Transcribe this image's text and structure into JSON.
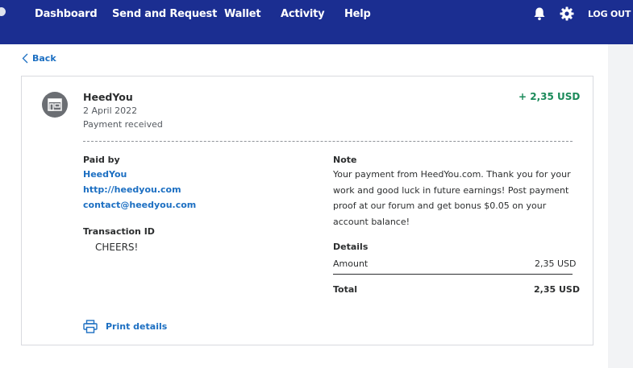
{
  "nav": {
    "items": [
      {
        "label": "Dashboard"
      },
      {
        "label": "Send and Request"
      },
      {
        "label": "Wallet"
      },
      {
        "label": "Activity"
      },
      {
        "label": "Help"
      }
    ],
    "logout_label": "LOG OUT",
    "bell_icon": "bell-icon",
    "gear_icon": "gear-icon",
    "brand_color": "#1b2e91"
  },
  "back_label": "Back",
  "transaction": {
    "merchant": "HeedYou",
    "date": "2 April 2022",
    "status": "Payment received",
    "amount": "+ 2,35 USD",
    "amount_color": "#1b8a5a"
  },
  "paid_by": {
    "heading": "Paid by",
    "name": "HeedYou",
    "website": "http://heedyou.com",
    "email": "contact@heedyou.com"
  },
  "transaction_id": {
    "heading": "Transaction ID",
    "value": "CHEERS!"
  },
  "note": {
    "heading": "Note",
    "text": "Your payment from HeedYou.com. Thank you for your work and good luck in future earnings! Post payment proof at our forum and get bonus $0.05 on your account balance!"
  },
  "details": {
    "heading": "Details",
    "amount_label": "Amount",
    "amount_value": "2,35 USD",
    "total_label": "Total",
    "total_value": "2,35 USD"
  },
  "print_label": "Print details"
}
